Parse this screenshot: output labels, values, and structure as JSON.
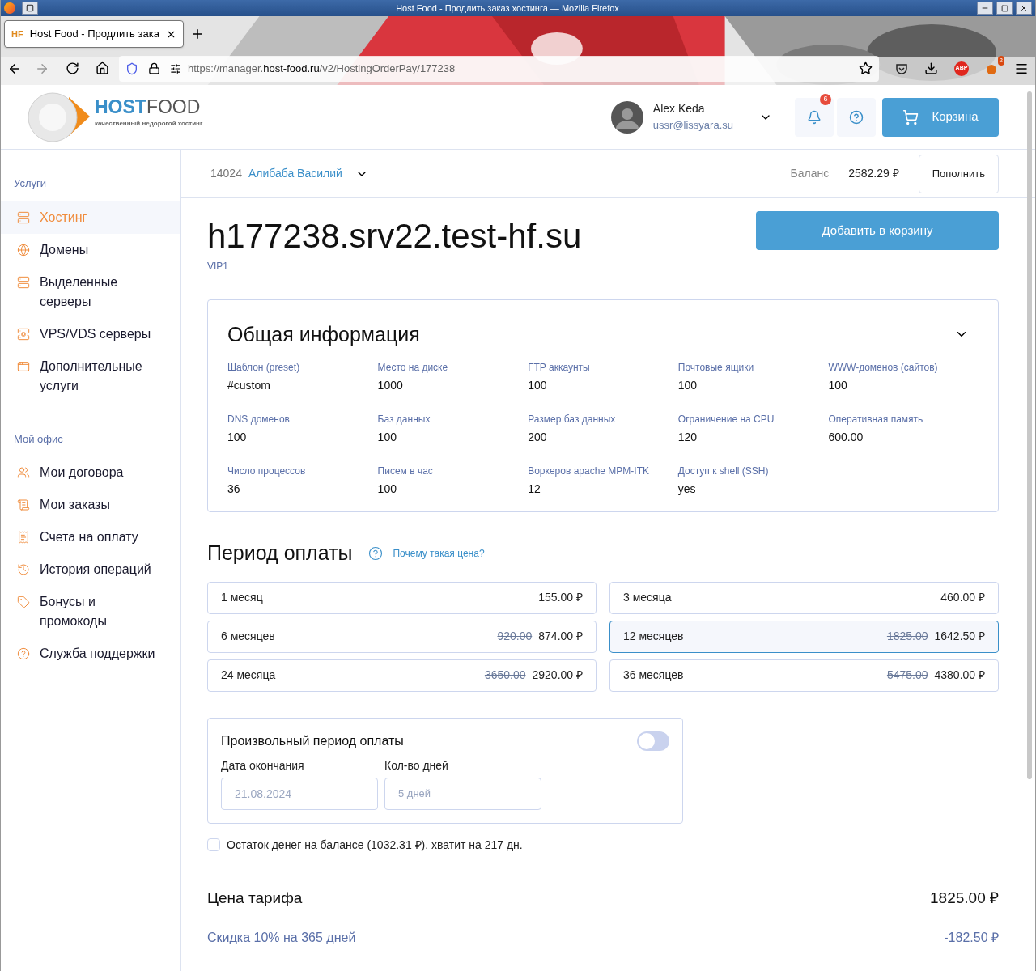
{
  "browser": {
    "window_title": "Host Food - Продлить заказ хостинга — Mozilla Firefox",
    "tab_title": "Host Food - Продлить зака",
    "tab_logo": "HF",
    "url": {
      "prefix": "https://manager.",
      "domain": "host-food.ru",
      "path": "/v2/HostingOrderPay/177238"
    },
    "adblock_label": "ABP",
    "extension_badge": "2"
  },
  "header": {
    "logo": {
      "host": "HOST",
      "food": "FOOD",
      "tagline": "качественный недорогой хостинг"
    },
    "user": {
      "name": "Alex Keda",
      "email": "ussr@lissyara.su"
    },
    "notifications_count": "6",
    "cart_button": "Корзина"
  },
  "sidebar": {
    "sections": [
      {
        "title": "Услуги",
        "items": [
          {
            "label": "Хостинг",
            "selected": true
          },
          {
            "label": "Домены",
            "selected": false
          },
          {
            "label": "Выделенные серверы",
            "selected": false
          },
          {
            "label": "VPS/VDS серверы",
            "selected": false
          },
          {
            "label": "Дополнительные услуги",
            "selected": false
          }
        ]
      },
      {
        "title": "Мой офис",
        "items": [
          {
            "label": "Мои договора",
            "selected": false
          },
          {
            "label": "Мои заказы",
            "selected": false
          },
          {
            "label": "Счета на оплату",
            "selected": false
          },
          {
            "label": "История операций",
            "selected": false
          },
          {
            "label": "Бонусы и промокоды",
            "selected": false
          },
          {
            "label": "Служба поддержки",
            "selected": false
          }
        ]
      }
    ]
  },
  "account": {
    "id": "14024",
    "name": "Алибаба Василий",
    "balance_label": "Баланс",
    "balance": "2582.29 ₽",
    "topup_button": "Пополнить"
  },
  "order": {
    "domain": "h177238.srv22.test-hf.su",
    "plan": "VIP1",
    "add_to_cart_button": "Добавить в корзину"
  },
  "info": {
    "title": "Общая информация",
    "fields": [
      {
        "label": "Шаблон (preset)",
        "value": "#custom"
      },
      {
        "label": "Место на диске",
        "value": "1000"
      },
      {
        "label": "FTP аккаунты",
        "value": "100"
      },
      {
        "label": "Почтовые ящики",
        "value": "100"
      },
      {
        "label": "WWW-доменов (сайтов)",
        "value": "100"
      },
      {
        "label": "DNS доменов",
        "value": "100"
      },
      {
        "label": "Баз данных",
        "value": "100"
      },
      {
        "label": "Размер баз данных",
        "value": "200"
      },
      {
        "label": "Ограничение на CPU",
        "value": "120"
      },
      {
        "label": "Оперативная память",
        "value": "600.00"
      },
      {
        "label": "Число процессов",
        "value": "36"
      },
      {
        "label": "Писем в час",
        "value": "100"
      },
      {
        "label": "Воркеров apache MPM-ITK",
        "value": "12"
      },
      {
        "label": "Доступ к shell (SSH)",
        "value": "yes"
      }
    ]
  },
  "period": {
    "title": "Период оплаты",
    "help_link": "Почему такая цена?",
    "options": [
      {
        "label": "1 месяц",
        "price": "155.00 ₽",
        "selected": false
      },
      {
        "label": "3 месяца",
        "price": "460.00 ₽",
        "selected": false
      },
      {
        "label": "6 месяцев",
        "old_price": "920.00",
        "price": "874.00 ₽",
        "selected": false
      },
      {
        "label": "12 месяцев",
        "old_price": "1825.00",
        "price": "1642.50 ₽",
        "selected": true
      },
      {
        "label": "24 месяца",
        "old_price": "3650.00",
        "price": "2920.00 ₽",
        "selected": false
      },
      {
        "label": "36 месяцев",
        "old_price": "5475.00",
        "price": "4380.00 ₽",
        "selected": false
      }
    ]
  },
  "custom_period": {
    "title": "Произвольный период оплаты",
    "on": false,
    "end_date_label": "Дата окончания",
    "end_date_placeholder": "21.08.2024",
    "days_label": "Кол-во дней",
    "days_placeholder": "5 дней"
  },
  "balance_option": {
    "text": "Остаток денег на балансе (1032.31 ₽), хватит на 217 дн.",
    "checked": false
  },
  "summary": [
    {
      "kind": "total",
      "label": "Цена тарифа",
      "value": "1825.00 ₽"
    },
    {
      "kind": "discount",
      "label": "Скидка 10% на 365 дней",
      "value": "-182.50 ₽"
    }
  ]
}
